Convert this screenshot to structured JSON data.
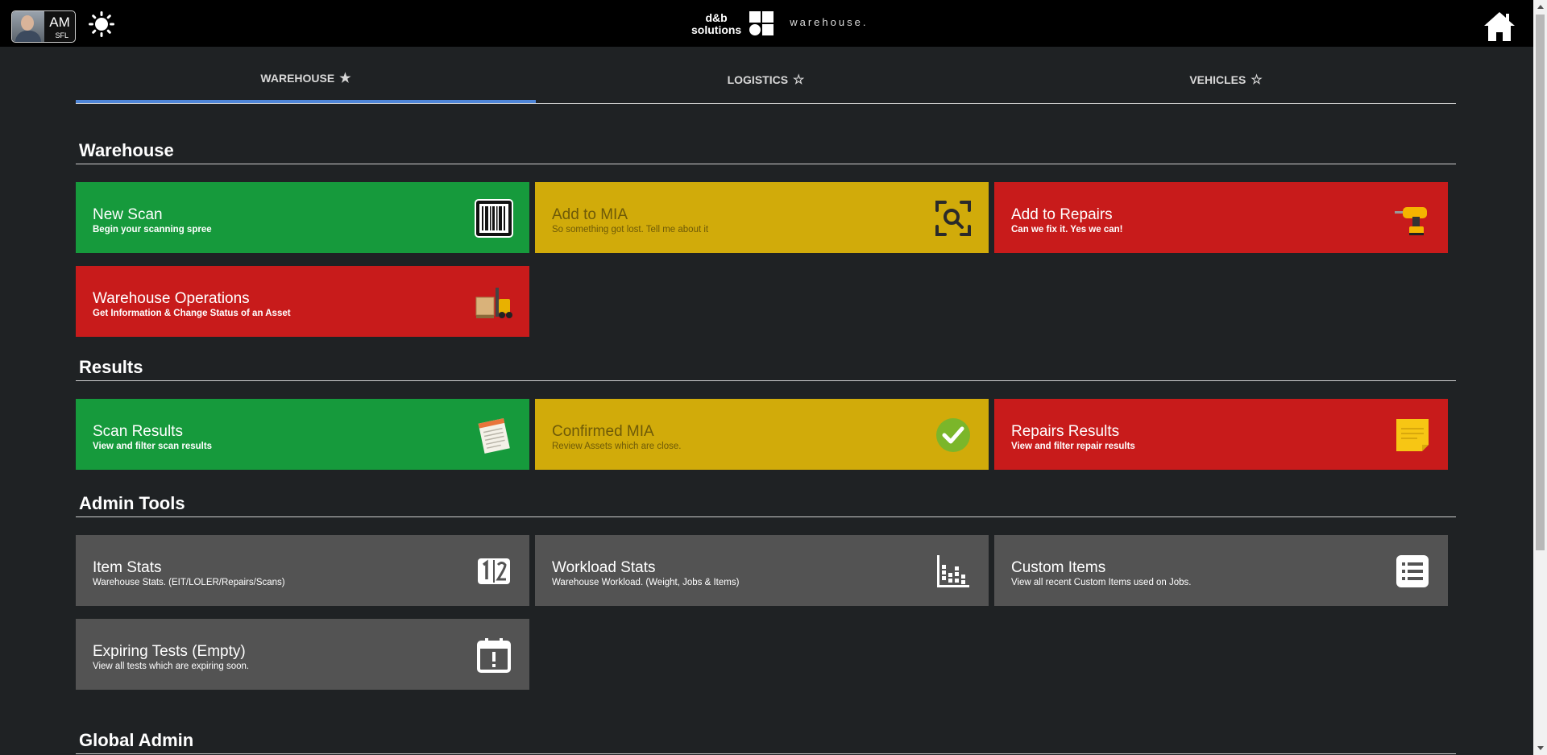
{
  "user": {
    "initials": "AM",
    "location": "SFL"
  },
  "brand": {
    "line1": "d&b",
    "line2": "solutions",
    "product": "warehouse."
  },
  "tabs": [
    {
      "label": "WAREHOUSE",
      "star": "★",
      "active": true
    },
    {
      "label": "LOGISTICS",
      "star": "☆",
      "active": false
    },
    {
      "label": "VEHICLES",
      "star": "☆",
      "active": false
    }
  ],
  "sections": {
    "warehouse": "Warehouse",
    "results": "Results",
    "admin": "Admin Tools",
    "global": "Global Admin"
  },
  "tiles": {
    "new_scan": {
      "title": "New Scan",
      "subtitle": "Begin your scanning spree",
      "icon": "barcode-icon",
      "color": "#169a3c"
    },
    "add_mia": {
      "title": "Add to MIA",
      "subtitle": "So something got lost. Tell me about it",
      "icon": "search-scan-icon",
      "color": "#d1ab0a"
    },
    "add_repairs": {
      "title": "Add to Repairs",
      "subtitle": "Can we fix it. Yes we can!",
      "icon": "drill-icon",
      "color": "#c81b1b"
    },
    "warehouse_ops": {
      "title": "Warehouse Operations",
      "subtitle": "Get Information & Change Status of an Asset",
      "icon": "forklift-icon",
      "color": "#c81b1b"
    },
    "scan_results": {
      "title": "Scan Results",
      "subtitle": "View and filter scan results",
      "icon": "notepad-icon",
      "color": "#169a3c"
    },
    "confirmed_mia": {
      "title": "Confirmed MIA",
      "subtitle": "Review Assets which are close.",
      "icon": "check-circle-icon",
      "color": "#d1ab0a"
    },
    "repairs_results": {
      "title": "Repairs Results",
      "subtitle": "View and filter repair results",
      "icon": "sticky-note-icon",
      "color": "#c81b1b"
    },
    "item_stats": {
      "title": "Item Stats",
      "subtitle": "Warehouse Stats. (EIT/LOLER/Repairs/Scans)",
      "icon": "counter-icon",
      "color": "#535353"
    },
    "workload_stats": {
      "title": "Workload Stats",
      "subtitle": "Warehouse Workload. (Weight, Jobs & Items)",
      "icon": "bar-chart-icon",
      "color": "#535353"
    },
    "custom_items": {
      "title": "Custom Items",
      "subtitle": "View all recent Custom Items used on Jobs.",
      "icon": "list-icon",
      "color": "#535353"
    },
    "expiring_tests": {
      "title": "Expiring Tests (Empty)",
      "subtitle": "View all tests which are expiring soon.",
      "icon": "calendar-alert-icon",
      "color": "#535353"
    }
  },
  "colors": {
    "tab_active": "#4f86d8",
    "background": "#1f2224",
    "topbar": "#000000"
  }
}
